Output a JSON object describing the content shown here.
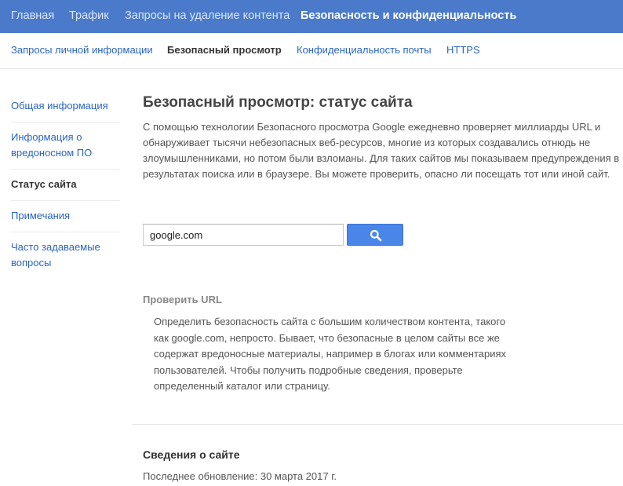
{
  "topnav": {
    "items": [
      {
        "label": "Главная"
      },
      {
        "label": "Трафик"
      },
      {
        "label": "Запросы на удаление контента"
      },
      {
        "label": "Безопасность и конфиденциальность"
      }
    ],
    "active_index": 3
  },
  "subnav": {
    "items": [
      {
        "label": "Запросы личной информации"
      },
      {
        "label": "Безопасный просмотр"
      },
      {
        "label": "Конфиденциальность почты"
      },
      {
        "label": "HTTPS"
      }
    ],
    "active_index": 1
  },
  "sidebar": {
    "items": [
      {
        "label": "Общая информация"
      },
      {
        "label": "Информация о вредоносном ПО"
      },
      {
        "label": "Статус сайта"
      },
      {
        "label": "Примечания"
      },
      {
        "label": "Часто задаваемые вопросы"
      }
    ],
    "active_index": 2
  },
  "main": {
    "title": "Безопасный просмотр: статус сайта",
    "intro": "С помощью технологии Безопасного просмотра Google ежедневно проверяет миллиарды URL и обнаруживает тысячи небезопасных веб-ресурсов, многие из которых создавались отнюдь не злоумышленниками, но потом были взломаны. Для таких сайтов мы показываем предупреждения в результатах поиска или в браузере. Вы можете проверить, опасно ли посещать тот или иной сайт."
  },
  "search": {
    "value": "google.com",
    "button_icon": "search-icon"
  },
  "check": {
    "title": "Проверить URL",
    "text": "Определить безопасность сайта с большим количеством контента, такого как google.com, непросто. Бывает, что безопасные в целом сайты все же содержат вредоносные материалы, например в блогах или комментариях пользователей. Чтобы получить подробные сведения, проверьте определенный каталог или страницу."
  },
  "site_info": {
    "title": "Сведения о сайте",
    "updated": "Последнее обновление: 30 марта 2017 г."
  },
  "colors": {
    "topbar": "#4a7ac9",
    "link": "#2a64c4",
    "button": "#4a86e8"
  }
}
